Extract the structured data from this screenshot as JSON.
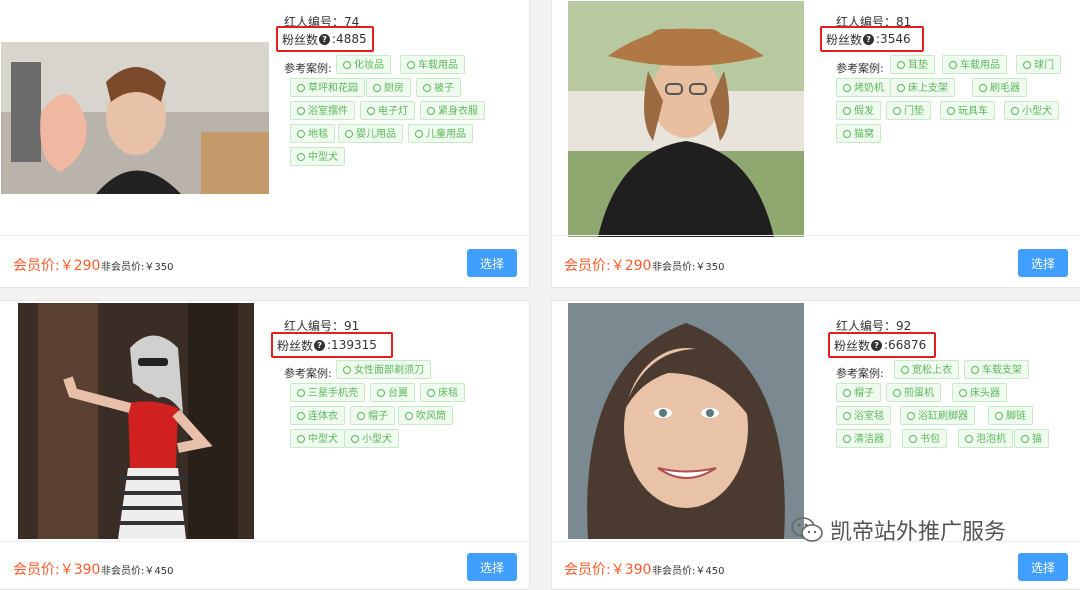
{
  "cards": [
    {
      "id_label": "红人编号：74",
      "fans_label": "粉丝数",
      "fans_value": ":4885",
      "tags_label": "参考案例:",
      "tags": [
        "化妆品",
        "车载用品",
        "草坪和花园",
        "厨房",
        "被子",
        "浴室摆件",
        "电子灯",
        "紧身衣服",
        "地毯",
        "婴儿用品",
        "儿童用品",
        "中型犬"
      ],
      "member_price": "会员价:￥290",
      "non_member_price": "非会员价:￥350",
      "select_label": "选择"
    },
    {
      "id_label": "红人编号：81",
      "fans_label": "粉丝数",
      "fans_value": ":3546",
      "tags_label": "参考案例:",
      "tags": [
        "耳垫",
        "车载用品",
        "球门",
        "烤奶机",
        "床上支架",
        "刷毛器",
        "假发",
        "门垫",
        "玩具车",
        "小型犬",
        "猫窝"
      ],
      "member_price": "会员价:￥290",
      "non_member_price": "非会员价:￥350",
      "select_label": "选择"
    },
    {
      "id_label": "红人编号：91",
      "fans_label": "粉丝数",
      "fans_value": ":139315",
      "tags_label": "参考案例:",
      "tags": [
        "女性面部剃须刀",
        "三星手机壳",
        "台翼",
        "床毯",
        "连体衣",
        "帽子",
        "吹风筒",
        "中型犬",
        "小型犬"
      ],
      "member_price": "会员价:￥390",
      "non_member_price": "非会员价:￥450",
      "select_label": "选择"
    },
    {
      "id_label": "红人编号：92",
      "fans_label": "粉丝数",
      "fans_value": ":66876",
      "tags_label": "参考案例:",
      "tags": [
        "宽松上衣",
        "车载支架",
        "帽子",
        "煎蛋机",
        "床头器",
        "浴室毯",
        "浴缸刷脚器",
        "脚链",
        "清洁器",
        "书包",
        "泡泡机",
        "猫"
      ],
      "member_price": "会员价:￥390",
      "non_member_price": "非会员价:￥450",
      "select_label": "选择"
    }
  ],
  "watermark": "凯帝站外推广服务"
}
